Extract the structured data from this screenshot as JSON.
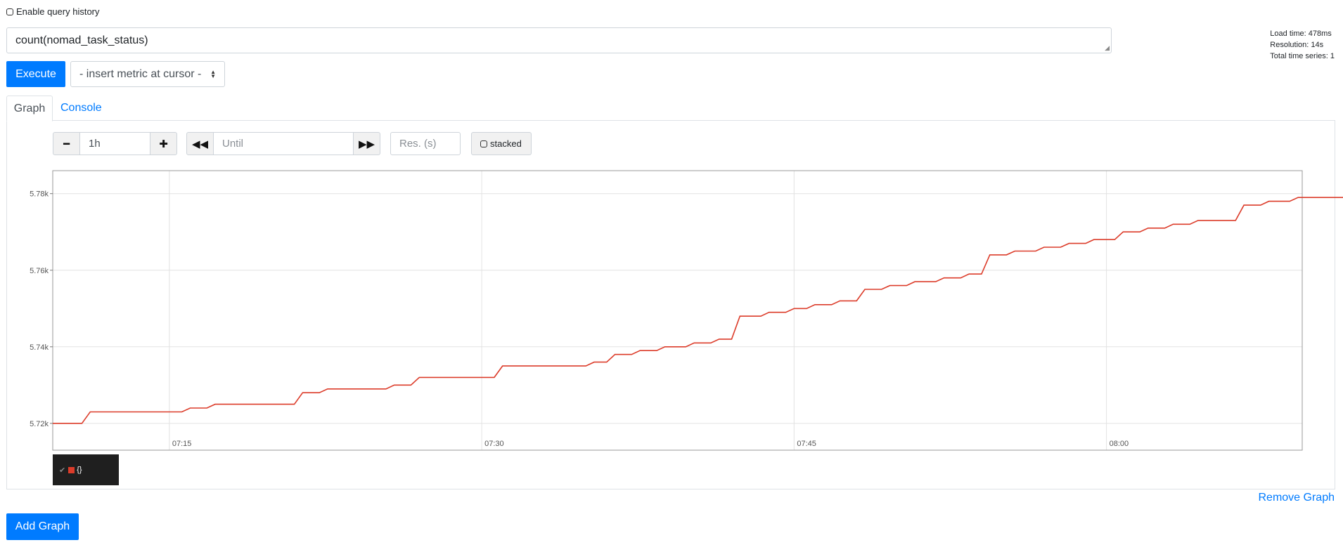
{
  "history": {
    "label": "Enable query history"
  },
  "query": {
    "expression": "count(nomad_task_status)"
  },
  "stats": {
    "load_time": "Load time: 478ms",
    "resolution": "Resolution: 14s",
    "total_series": "Total time series: 1"
  },
  "toolbar": {
    "execute_label": "Execute",
    "metric_select": "- insert metric at cursor -"
  },
  "tabs": [
    {
      "label": "Graph",
      "active": true
    },
    {
      "label": "Console",
      "active": false
    }
  ],
  "graph_controls": {
    "range_value": "1h",
    "until_placeholder": "Until",
    "resolution_placeholder": "Res. (s)",
    "stacked_label": "stacked"
  },
  "legend": {
    "series_label": "{}"
  },
  "actions": {
    "remove_graph": "Remove Graph",
    "add_graph": "Add Graph"
  },
  "colors": {
    "accent": "#007bff",
    "series": "#dc3c2a"
  },
  "chart_data": {
    "type": "line",
    "title": "",
    "xlabel": "",
    "ylabel": "",
    "x_ticks": [
      "07:15",
      "07:30",
      "07:45",
      "08:00"
    ],
    "y_ticks": [
      "5.72k",
      "5.74k",
      "5.76k",
      "5.78k"
    ],
    "ylim": [
      5713,
      5786
    ],
    "xlim_minutes": [
      9.4,
      69.4
    ],
    "grid": true,
    "legend": "bottom-left",
    "series": [
      {
        "name": "{}",
        "color": "#dc3c2a",
        "points": [
          [
            "07:09:24",
            5720
          ],
          [
            "07:10:48",
            5720
          ],
          [
            "07:11:12",
            5723
          ],
          [
            "07:15:36",
            5723
          ],
          [
            "07:16:00",
            5724
          ],
          [
            "07:16:48",
            5724
          ],
          [
            "07:17:12",
            5725
          ],
          [
            "07:21:00",
            5725
          ],
          [
            "07:21:24",
            5728
          ],
          [
            "07:22:12",
            5728
          ],
          [
            "07:22:36",
            5729
          ],
          [
            "07:25:24",
            5729
          ],
          [
            "07:25:48",
            5730
          ],
          [
            "07:26:36",
            5730
          ],
          [
            "07:27:00",
            5732
          ],
          [
            "07:30:36",
            5732
          ],
          [
            "07:31:00",
            5735
          ],
          [
            "07:35:00",
            5735
          ],
          [
            "07:35:24",
            5736
          ],
          [
            "07:36:00",
            5736
          ],
          [
            "07:36:24",
            5738
          ],
          [
            "07:37:12",
            5738
          ],
          [
            "07:37:36",
            5739
          ],
          [
            "07:38:24",
            5739
          ],
          [
            "07:38:48",
            5740
          ],
          [
            "07:39:48",
            5740
          ],
          [
            "07:40:12",
            5741
          ],
          [
            "07:41:00",
            5741
          ],
          [
            "07:41:24",
            5742
          ],
          [
            "07:42:00",
            5742
          ],
          [
            "07:42:24",
            5748
          ],
          [
            "07:43:24",
            5748
          ],
          [
            "07:43:48",
            5749
          ],
          [
            "07:44:36",
            5749
          ],
          [
            "07:45:00",
            5750
          ],
          [
            "07:45:36",
            5750
          ],
          [
            "07:46:00",
            5751
          ],
          [
            "07:46:48",
            5751
          ],
          [
            "07:47:12",
            5752
          ],
          [
            "07:48:00",
            5752
          ],
          [
            "07:48:24",
            5755
          ],
          [
            "07:49:12",
            5755
          ],
          [
            "07:49:36",
            5756
          ],
          [
            "07:50:24",
            5756
          ],
          [
            "07:50:48",
            5757
          ],
          [
            "07:51:48",
            5757
          ],
          [
            "07:52:12",
            5758
          ],
          [
            "07:53:00",
            5758
          ],
          [
            "07:53:24",
            5759
          ],
          [
            "07:54:00",
            5759
          ],
          [
            "07:54:24",
            5764
          ],
          [
            "07:55:12",
            5764
          ],
          [
            "07:55:36",
            5765
          ],
          [
            "07:56:36",
            5765
          ],
          [
            "07:57:00",
            5766
          ],
          [
            "07:57:48",
            5766
          ],
          [
            "07:58:12",
            5767
          ],
          [
            "07:59:00",
            5767
          ],
          [
            "07:59:24",
            5768
          ],
          [
            "08:00:24",
            5768
          ],
          [
            "08:00:48",
            5770
          ],
          [
            "08:01:36",
            5770
          ],
          [
            "08:02:00",
            5771
          ],
          [
            "08:02:48",
            5771
          ],
          [
            "08:03:12",
            5772
          ],
          [
            "08:04:00",
            5772
          ],
          [
            "08:04:24",
            5773
          ],
          [
            "08:06:12",
            5773
          ],
          [
            "08:06:36",
            5777
          ],
          [
            "08:07:24",
            5777
          ],
          [
            "08:07:48",
            5778
          ],
          [
            "08:08:48",
            5778
          ],
          [
            "08:09:12",
            5779
          ],
          [
            "08:11:36",
            5779
          ],
          [
            "08:12:00",
            5781
          ],
          [
            "08:15:24",
            5781
          ]
        ]
      }
    ]
  }
}
